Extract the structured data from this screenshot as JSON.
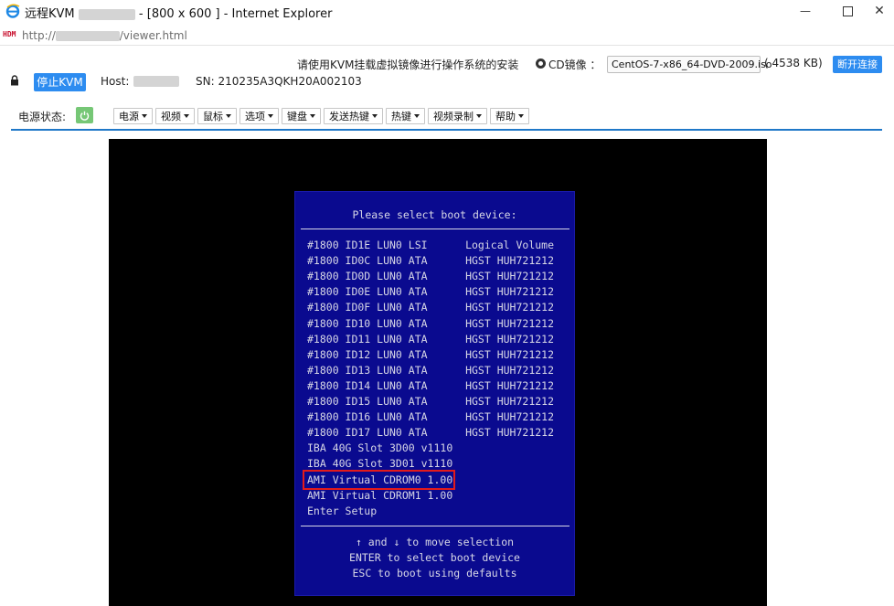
{
  "window": {
    "title_prefix": "远程KVM",
    "title_suffix": "- [800 x 600 ] - Internet Explorer",
    "minimize_symbol": "—",
    "close_symbol": "✕"
  },
  "address": {
    "badge": "HDM",
    "url_prefix": "http://",
    "url_suffix": "/viewer.html"
  },
  "kvm_header": {
    "notice": "请使用KVM挂载虚拟镜像进行操作系统的安装",
    "cd_label": "CD镜像 ：",
    "iso_name": "CentOS-7-x86_64-DVD-2009.iso",
    "iso_size": "( 4538 KB)",
    "disconnect_label": "断开连接",
    "stop_kvm_label": "停止KVM",
    "host_label": "Host:",
    "sn_label": "SN: 210235A3QKH20A002103"
  },
  "toolbar": {
    "power_status_label": "电源状态:",
    "power_state_color": "#76c776",
    "menus": [
      "电源",
      "视频",
      "鼠标",
      "选项",
      "键盘",
      "发送热键",
      "热键",
      "视频录制",
      "帮助"
    ]
  },
  "bios": {
    "title": "Please select boot device:",
    "items": [
      "#1800 ID1E LUN0 LSI      Logical Volume",
      "#1800 ID0C LUN0 ATA      HGST HUH721212",
      "#1800 ID0D LUN0 ATA      HGST HUH721212",
      "#1800 ID0E LUN0 ATA      HGST HUH721212",
      "#1800 ID0F LUN0 ATA      HGST HUH721212",
      "#1800 ID10 LUN0 ATA      HGST HUH721212",
      "#1800 ID11 LUN0 ATA      HGST HUH721212",
      "#1800 ID12 LUN0 ATA      HGST HUH721212",
      "#1800 ID13 LUN0 ATA      HGST HUH721212",
      "#1800 ID14 LUN0 ATA      HGST HUH721212",
      "#1800 ID15 LUN0 ATA      HGST HUH721212",
      "#1800 ID16 LUN0 ATA      HGST HUH721212",
      "#1800 ID17 LUN0 ATA      HGST HUH721212",
      "IBA 40G Slot 3D00 v1110",
      "IBA 40G Slot 3D01 v1110",
      "AMI Virtual CDROM0 1.00",
      "AMI Virtual CDROM1 1.00",
      "Enter Setup"
    ],
    "selected_index": 15,
    "help": [
      "↑ and ↓ to move selection",
      "ENTER to select boot device",
      "ESC to boot using defaults"
    ],
    "colors": {
      "background": "#0a0a8f",
      "text": "#d7d7e6",
      "highlight_box": "#e21b1b"
    }
  }
}
